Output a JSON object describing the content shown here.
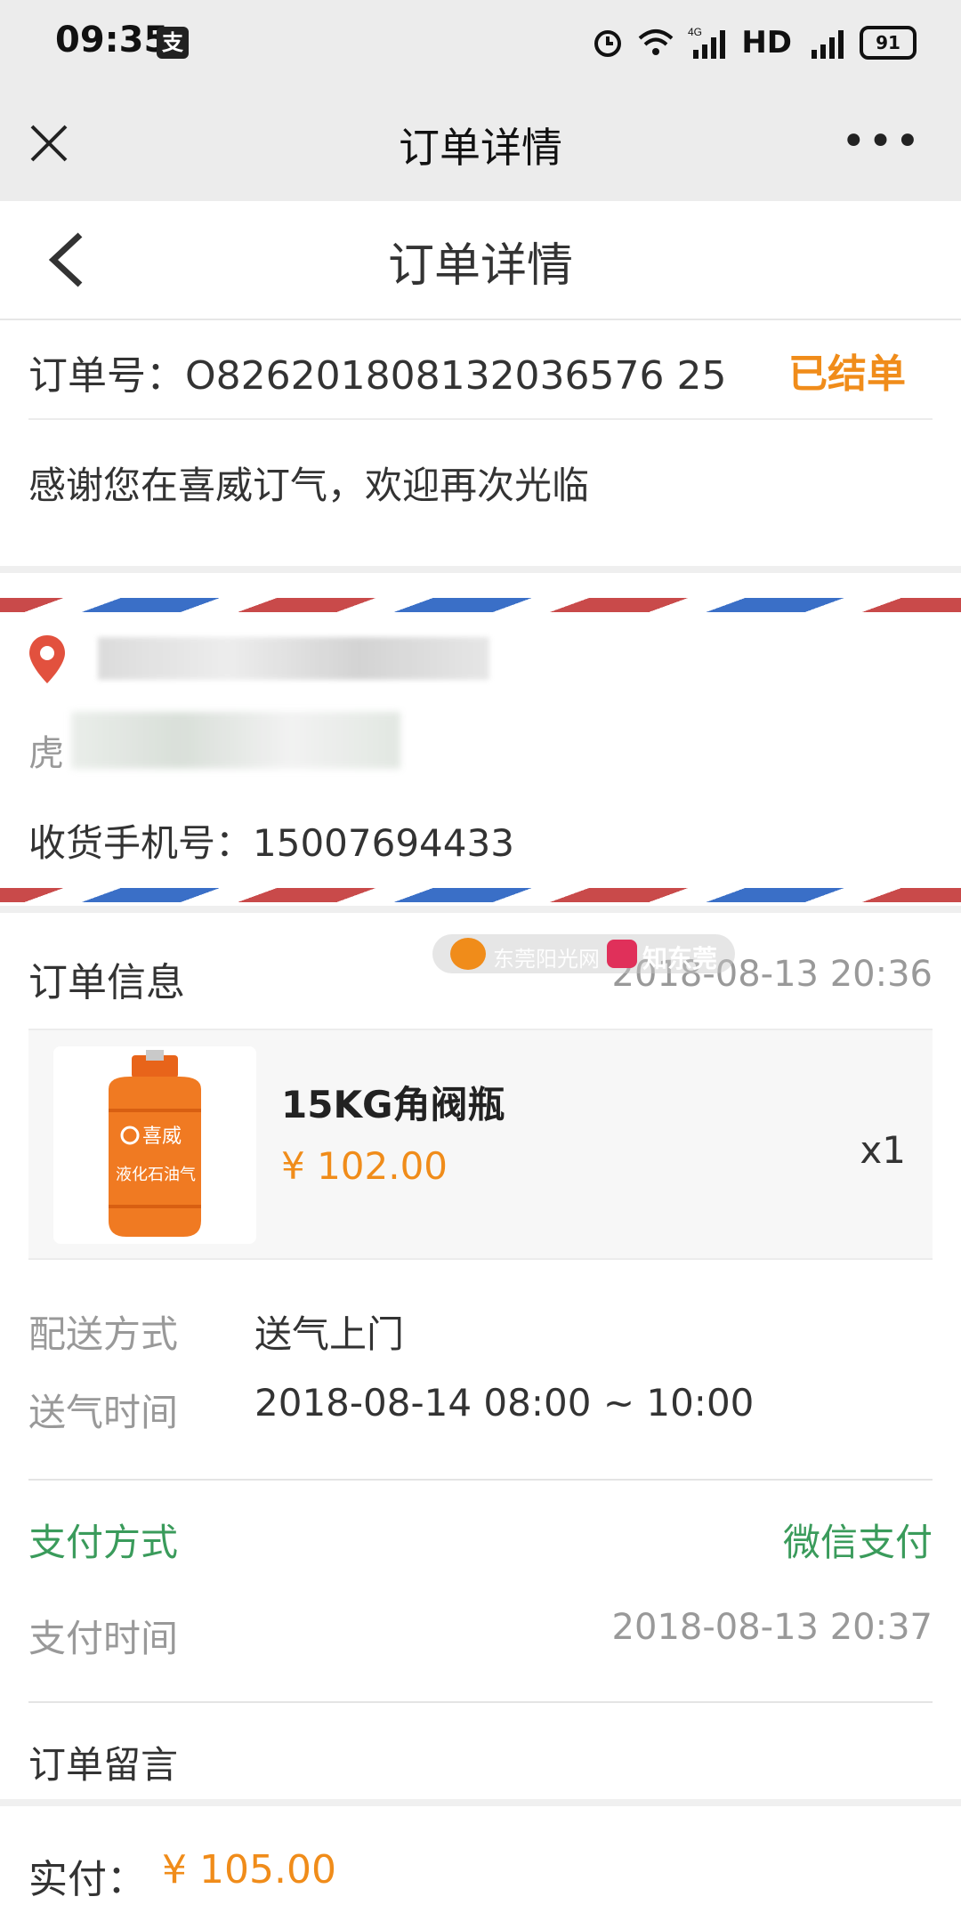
{
  "status_bar": {
    "time": "09:35",
    "app_icon": "支",
    "network": "4G",
    "hd": "HD",
    "battery": "91"
  },
  "wechat_nav": {
    "title": "订单详情",
    "close_icon": "close-icon",
    "more": "•••"
  },
  "page": {
    "title": "订单详情"
  },
  "order": {
    "number_text": "订单号：O826201808132036576 25",
    "status": "已结单",
    "thanks": "感谢您在喜威订气，欢迎再次光临"
  },
  "address": {
    "name_prefix": "虎",
    "phone_text": "收货手机号：15007694433"
  },
  "order_info": {
    "title": "订单信息",
    "created_time": "2018-08-13 20:36"
  },
  "watermark": {
    "site": "东莞阳光网",
    "brand": "知东莞"
  },
  "product": {
    "name": "15KG角阀瓶",
    "price": "¥ 102.00",
    "qty": "x1",
    "cylinder_brand": "喜威",
    "cylinder_text": "液化石油气"
  },
  "delivery": {
    "method_label": "配送方式",
    "method_value": "送气上门",
    "time_label": "送气时间",
    "time_value": "2018-08-14 08:00 ~ 10:00"
  },
  "payment": {
    "method_label": "支付方式",
    "method_value": "微信支付",
    "time_label": "支付时间",
    "time_value": "2018-08-13 20:37"
  },
  "memo": {
    "label": "订单留言"
  },
  "footer": {
    "paid_label": "实付：",
    "paid_value": "¥ 105.00"
  },
  "colors": {
    "accent_orange": "#f08c1a",
    "pay_green": "#3a9b5b",
    "airmail_red": "#c94a4a",
    "airmail_blue": "#3a6fc7"
  }
}
